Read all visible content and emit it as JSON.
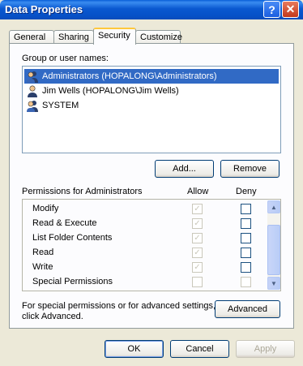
{
  "window": {
    "title": "Data Properties",
    "help_glyph": "?",
    "close_glyph": "✕"
  },
  "tabs": [
    {
      "label": "General"
    },
    {
      "label": "Sharing"
    },
    {
      "label": "Security",
      "active": true
    },
    {
      "label": "Customize"
    }
  ],
  "group": {
    "label": "Group or user names:",
    "users": [
      {
        "name": "Administrators (HOPALONG\\Administrators)",
        "selected": true,
        "icon": "users-group-icon"
      },
      {
        "name": "Jim Wells (HOPALONG\\Jim Wells)",
        "selected": false,
        "icon": "user-icon"
      },
      {
        "name": "SYSTEM",
        "selected": false,
        "icon": "users-group-icon"
      }
    ],
    "add_label": "Add...",
    "remove_label": "Remove"
  },
  "permissions": {
    "header": "Permissions for Administrators",
    "allow_header": "Allow",
    "deny_header": "Deny",
    "rows": [
      {
        "name": "Modify",
        "allow": true,
        "allow_disabled": true,
        "deny": false
      },
      {
        "name": "Read & Execute",
        "allow": true,
        "allow_disabled": true,
        "deny": false
      },
      {
        "name": "List Folder Contents",
        "allow": true,
        "allow_disabled": true,
        "deny": false
      },
      {
        "name": "Read",
        "allow": true,
        "allow_disabled": true,
        "deny": false
      },
      {
        "name": "Write",
        "allow": true,
        "allow_disabled": true,
        "deny": false
      },
      {
        "name": "Special Permissions",
        "allow": false,
        "allow_disabled": true,
        "deny": false,
        "deny_disabled": true
      }
    ]
  },
  "advanced": {
    "note_line1": "For special permissions or for advanced settings,",
    "note_line2": "click Advanced.",
    "button_label": "Advanced"
  },
  "footer": {
    "ok_label": "OK",
    "cancel_label": "Cancel",
    "apply_label": "Apply"
  },
  "colors": {
    "title_bar": "#0a58d0",
    "selection": "#316ac5",
    "dialog_bg": "#ece9d8"
  }
}
